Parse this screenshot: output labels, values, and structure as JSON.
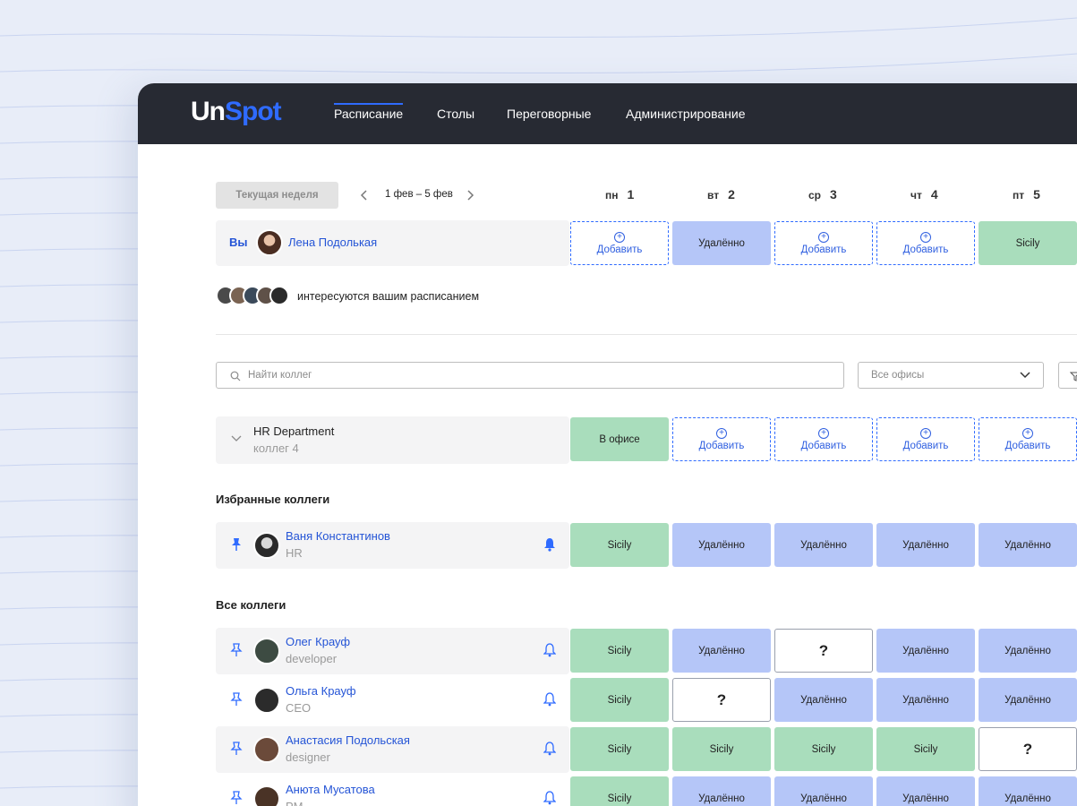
{
  "app": {
    "logo_part1": "Un",
    "logo_part2": "Spot"
  },
  "nav": [
    {
      "label": "Расписание",
      "active": true
    },
    {
      "label": "Столы",
      "active": false
    },
    {
      "label": "Переговорные",
      "active": false
    },
    {
      "label": "Администрирование",
      "active": false
    }
  ],
  "week": {
    "current_label": "Текущая неделя",
    "range": "1 фев – 5 фев",
    "days": [
      {
        "name": "пн",
        "num": "1"
      },
      {
        "name": "вт",
        "num": "2"
      },
      {
        "name": "ср",
        "num": "3"
      },
      {
        "name": "чт",
        "num": "4"
      },
      {
        "name": "пт",
        "num": "5"
      }
    ]
  },
  "you": {
    "label": "Вы",
    "name": "Лена Подолькая",
    "cells": [
      {
        "type": "add",
        "text": "Добавить"
      },
      {
        "type": "remote",
        "text": "Удалённо"
      },
      {
        "type": "add",
        "text": "Добавить"
      },
      {
        "type": "add",
        "text": "Добавить"
      },
      {
        "type": "office",
        "text": "Sicily"
      }
    ]
  },
  "watchers_text": "интересуются вашим расписанием",
  "search": {
    "placeholder": "Найти коллег"
  },
  "office_filter": {
    "value": "Все офисы"
  },
  "department": {
    "name": "HR Department",
    "count": "коллег 4",
    "cells": [
      {
        "type": "office",
        "text": "В офисе"
      },
      {
        "type": "add",
        "text": "Добавить"
      },
      {
        "type": "add",
        "text": "Добавить"
      },
      {
        "type": "add",
        "text": "Добавить"
      },
      {
        "type": "add",
        "text": "Добавить"
      }
    ]
  },
  "favorites": {
    "title": "Избранные коллеги",
    "people": [
      {
        "name": "Ваня Константинов",
        "role": "HR",
        "pinned": true,
        "bell_filled": true,
        "cells": [
          {
            "type": "office",
            "text": "Sicily"
          },
          {
            "type": "remote",
            "text": "Удалённо"
          },
          {
            "type": "remote",
            "text": "Удалённо"
          },
          {
            "type": "remote",
            "text": "Удалённо"
          },
          {
            "type": "remote",
            "text": "Удалённо"
          }
        ]
      }
    ]
  },
  "all": {
    "title": "Все коллеги",
    "people": [
      {
        "name": "Олег Крауф",
        "role": "developer",
        "cells": [
          {
            "type": "office",
            "text": "Sicily"
          },
          {
            "type": "remote",
            "text": "Удалённо"
          },
          {
            "type": "unknown",
            "text": "?"
          },
          {
            "type": "remote",
            "text": "Удалённо"
          },
          {
            "type": "remote",
            "text": "Удалённо"
          }
        ]
      },
      {
        "name": "Ольга Крауф",
        "role": "CEO",
        "cells": [
          {
            "type": "office",
            "text": "Sicily"
          },
          {
            "type": "unknown",
            "text": "?"
          },
          {
            "type": "remote",
            "text": "Удалённо"
          },
          {
            "type": "remote",
            "text": "Удалённо"
          },
          {
            "type": "remote",
            "text": "Удалённо"
          }
        ]
      },
      {
        "name": "Анастасия Подольская",
        "role": "designer",
        "cells": [
          {
            "type": "office",
            "text": "Sicily"
          },
          {
            "type": "office",
            "text": "Sicily"
          },
          {
            "type": "office",
            "text": "Sicily"
          },
          {
            "type": "office",
            "text": "Sicily"
          },
          {
            "type": "unknown",
            "text": "?"
          }
        ]
      },
      {
        "name": "Анюта Мусатова",
        "role": "PM",
        "cells": [
          {
            "type": "office",
            "text": "Sicily"
          },
          {
            "type": "remote",
            "text": "Удалённо"
          },
          {
            "type": "remote",
            "text": "Удалённо"
          },
          {
            "type": "remote",
            "text": "Удалённо"
          },
          {
            "type": "remote",
            "text": "Удалённо"
          }
        ]
      }
    ]
  },
  "colors": {
    "accent": "#2f6bff",
    "topbar": "#272a33",
    "office": "#a9ddbc",
    "remote": "#b5c6f8"
  }
}
